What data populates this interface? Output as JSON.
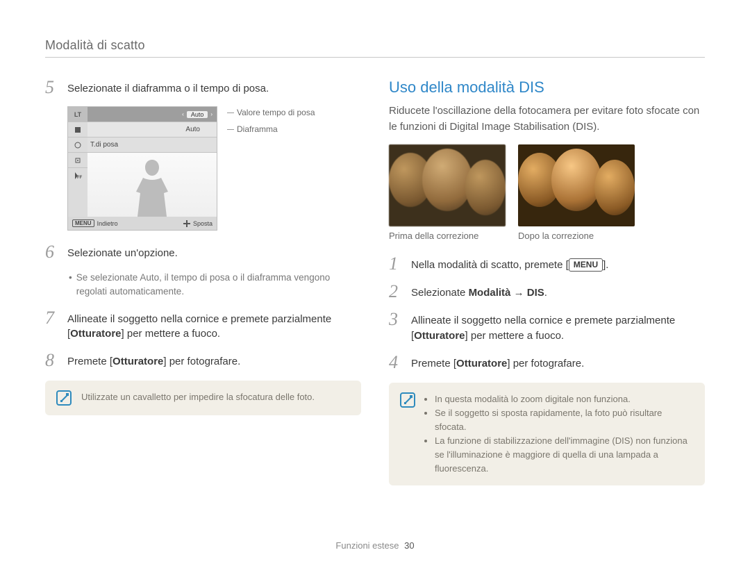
{
  "header": {
    "title": "Modalità di scatto"
  },
  "left": {
    "steps": {
      "s5": {
        "num": "5",
        "text": "Selezionate il diaframma o il tempo di posa."
      },
      "s6": {
        "num": "6",
        "text": "Selezionate un'opzione.",
        "bullet_prefix": "Se selezionate ",
        "bullet_bold": "Auto",
        "bullet_suffix": ", il tempo di posa o il diaframma vengono regolati automaticamente."
      },
      "s7": {
        "num": "7",
        "text_a": "Allineate il soggetto nella cornice e premete parzialmente [",
        "bold": "Otturatore",
        "text_b": "] per mettere a fuoco."
      },
      "s8": {
        "num": "8",
        "text_a": "Premete [",
        "bold": "Otturatore",
        "text_b": "] per fotografare."
      }
    },
    "camera": {
      "lt": "LT",
      "row1_left": "‹",
      "row1_value": "Auto",
      "row1_right": "›",
      "row2_value": "Auto",
      "tdiposa": "T.di posa",
      "status_menu": "MENU",
      "status_back": "Indietro",
      "status_move": "Sposta",
      "callout1": "Valore tempo di posa",
      "callout2": "Diaframma"
    },
    "note": "Utilizzate un cavalletto per impedire la sfocatura delle foto."
  },
  "right": {
    "title": "Uso della modalità DIS",
    "intro": "Riducete l'oscillazione della fotocamera per evitare foto sfocate con le funzioni di Digital Image Stabilisation (DIS).",
    "caption_before": "Prima della correzione",
    "caption_after": "Dopo la correzione",
    "steps": {
      "s1": {
        "num": "1",
        "text_a": "Nella modalità di scatto, premete [",
        "menu": "MENU",
        "text_b": "]."
      },
      "s2": {
        "num": "2",
        "text_a": "Selezionate ",
        "bold1": "Modalità",
        "arrow": " → ",
        "bold2": "DIS",
        "text_b": "."
      },
      "s3": {
        "num": "3",
        "text_a": "Allineate il soggetto nella cornice e premete parzialmente [",
        "bold": "Otturatore",
        "text_b": "] per mettere a fuoco."
      },
      "s4": {
        "num": "4",
        "text_a": "Premete [",
        "bold": "Otturatore",
        "text_b": "] per fotografare."
      }
    },
    "notes": {
      "n1": "In questa modalità lo zoom digitale non funziona.",
      "n2": "Se il soggetto si sposta rapidamente, la foto può risultare sfocata.",
      "n3": "La funzione di stabilizzazione dell'immagine (DIS) non funziona se l'illuminazione è maggiore di quella di una lampada a fluorescenza."
    }
  },
  "footer": {
    "section": "Funzioni estese",
    "page": "30"
  }
}
